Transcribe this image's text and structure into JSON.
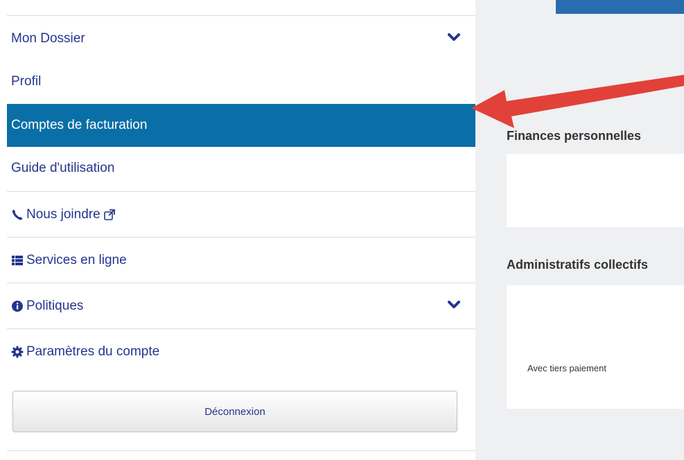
{
  "sidebar": {
    "items": [
      {
        "label": "Mon Dossier"
      },
      {
        "label": "Profil"
      },
      {
        "label": "Comptes de facturation"
      },
      {
        "label": "Guide d'utilisation"
      },
      {
        "label": "Nous joindre"
      },
      {
        "label": "Services en ligne"
      },
      {
        "label": "Politiques"
      },
      {
        "label": "Paramètres du compte"
      }
    ],
    "logout_label": "Déconnexion"
  },
  "main": {
    "section1_title": "Finances personnelles",
    "section2_title": "Administratifs collectifs",
    "card2_text": "Avec tiers paiement"
  },
  "colors": {
    "active_bg": "#0a6fa6",
    "link": "#25358e",
    "annotation_arrow": "#e2413a"
  }
}
